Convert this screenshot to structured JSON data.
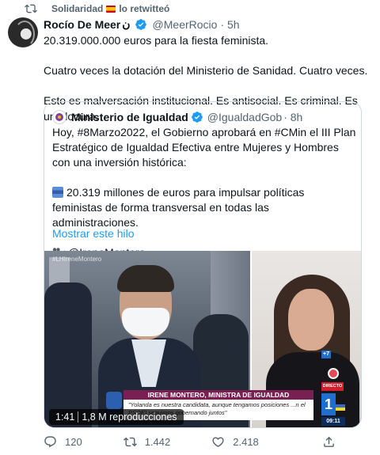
{
  "social_context": {
    "before_flag": "Solidaridad",
    "after_flag": "lo retwitteó",
    "icon": "retweet-icon"
  },
  "tweet": {
    "author_name": "Rocío De Meer",
    "author_extra": "ن",
    "author_handle": "@MeerRocio",
    "time": "· 5h",
    "text": [
      "20.319.000.000 euros para la fiesta feminista.",
      "Cuatro veces la dotación del Ministerio de Sanidad. Cuatro veces.",
      "Esto es malversación institucional. Es antisocial. Es criminal. Es una locura."
    ]
  },
  "quoted_tweet": {
    "author_name": "Ministerio de Igualdad",
    "author_handle": "@IgualdadGob",
    "time": "· 8h",
    "paragraph1": "Hoy, #8Marzo2022, el Gobierno aprobará en #CMin el III Plan Estratégico de Igualdad Efectiva entre Mujeres y Hombres con una inversión histórica:",
    "paragraph2": "20.319 millones de euros para impulsar políticas feministas de forma transversal en todas las administraciones.",
    "paragraph3": "@IreneMontero",
    "show_thread": "Mostrar este hilo",
    "video": {
      "hashtag_watermark": "#LHIreneMontero",
      "lower_third": "IRENE MONTERO, MINISTRA DE IGUALDAD",
      "caption": "\"Yolanda es nuestra candidata, aunque tengamos posiciones ...n el PSOE) seguimos gobernando juntos\"",
      "channel_number": "1",
      "channel_small": "+7",
      "live_label": "DIRECTO",
      "broadcast_time": "09:11",
      "duration": "1:41",
      "views": "1,8 M reproducciones"
    }
  },
  "actions": {
    "replies": "120",
    "retweets": "1.442",
    "likes": "2.418"
  },
  "colors": {
    "text": "#0f1419",
    "secondary": "#536471",
    "link": "#1d9bf0",
    "border": "#cfd9de",
    "verified": "#1d9bf0"
  }
}
